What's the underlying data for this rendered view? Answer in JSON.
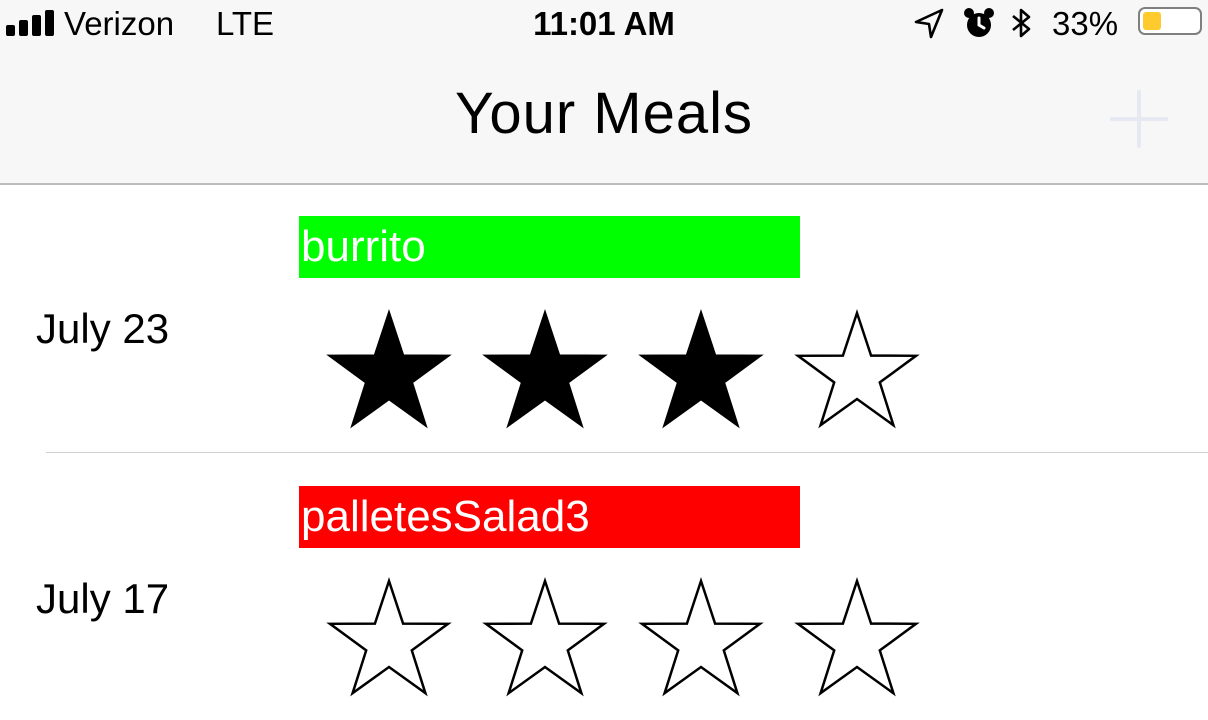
{
  "status_bar": {
    "carrier": "Verizon",
    "network": "LTE",
    "time": "11:01 AM",
    "battery_percent": "33%",
    "battery_level": 0.33,
    "battery_color": "#fecb2e",
    "icons": [
      "location-arrow-icon",
      "alarm-icon",
      "bluetooth-icon"
    ]
  },
  "nav_bar": {
    "title": "Your Meals",
    "add_icon": "plus-icon"
  },
  "meals": [
    {
      "date": "July 23",
      "name": "burrito",
      "name_bg": "#00ff00",
      "rating": 3,
      "max_rating": 4
    },
    {
      "date": "July 17",
      "name": "palletesSalad3",
      "name_bg": "#ff0000",
      "rating": 0,
      "max_rating": 4
    }
  ]
}
